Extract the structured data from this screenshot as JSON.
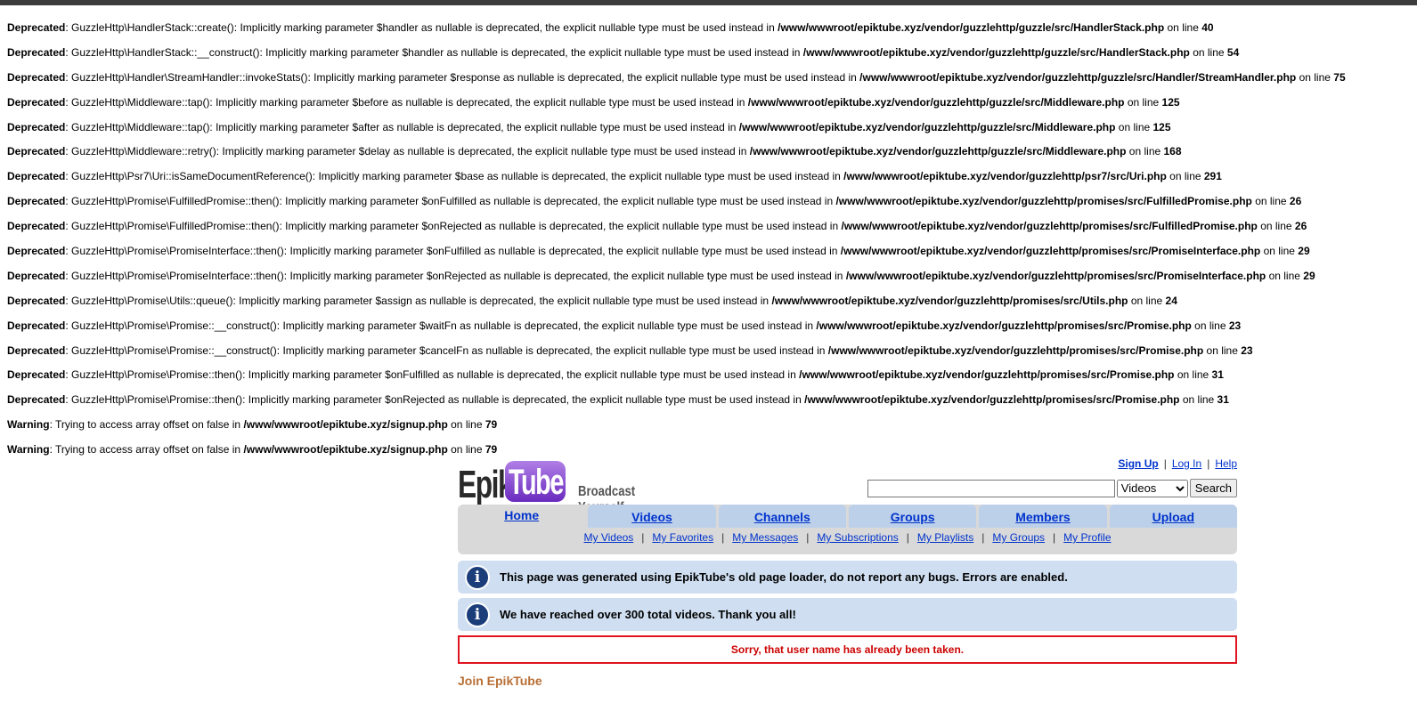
{
  "errors": [
    {
      "level": "Deprecated",
      "msg": ": GuzzleHttp\\HandlerStack::create(): Implicitly marking parameter $handler as nullable is deprecated, the explicit nullable type must be used instead in ",
      "file": "/www/wwwroot/epiktube.xyz/vendor/guzzlehttp/guzzle/src/HandlerStack.php",
      "on": " on line ",
      "line": "40"
    },
    {
      "level": "Deprecated",
      "msg": ": GuzzleHttp\\HandlerStack::__construct(): Implicitly marking parameter $handler as nullable is deprecated, the explicit nullable type must be used instead in ",
      "file": "/www/wwwroot/epiktube.xyz/vendor/guzzlehttp/guzzle/src/HandlerStack.php",
      "on": " on line ",
      "line": "54"
    },
    {
      "level": "Deprecated",
      "msg": ": GuzzleHttp\\Handler\\StreamHandler::invokeStats(): Implicitly marking parameter $response as nullable is deprecated, the explicit nullable type must be used instead in ",
      "file": "/www/wwwroot/epiktube.xyz/vendor/guzzlehttp/guzzle/src/Handler/StreamHandler.php",
      "on": " on line ",
      "line": "75"
    },
    {
      "level": "Deprecated",
      "msg": ": GuzzleHttp\\Middleware::tap(): Implicitly marking parameter $before as nullable is deprecated, the explicit nullable type must be used instead in ",
      "file": "/www/wwwroot/epiktube.xyz/vendor/guzzlehttp/guzzle/src/Middleware.php",
      "on": " on line ",
      "line": "125"
    },
    {
      "level": "Deprecated",
      "msg": ": GuzzleHttp\\Middleware::tap(): Implicitly marking parameter $after as nullable is deprecated, the explicit nullable type must be used instead in ",
      "file": "/www/wwwroot/epiktube.xyz/vendor/guzzlehttp/guzzle/src/Middleware.php",
      "on": " on line ",
      "line": "125"
    },
    {
      "level": "Deprecated",
      "msg": ": GuzzleHttp\\Middleware::retry(): Implicitly marking parameter $delay as nullable is deprecated, the explicit nullable type must be used instead in ",
      "file": "/www/wwwroot/epiktube.xyz/vendor/guzzlehttp/guzzle/src/Middleware.php",
      "on": " on line ",
      "line": "168"
    },
    {
      "level": "Deprecated",
      "msg": ": GuzzleHttp\\Psr7\\Uri::isSameDocumentReference(): Implicitly marking parameter $base as nullable is deprecated, the explicit nullable type must be used instead in ",
      "file": "/www/wwwroot/epiktube.xyz/vendor/guzzlehttp/psr7/src/Uri.php",
      "on": " on line ",
      "line": "291"
    },
    {
      "level": "Deprecated",
      "msg": ": GuzzleHttp\\Promise\\FulfilledPromise::then(): Implicitly marking parameter $onFulfilled as nullable is deprecated, the explicit nullable type must be used instead in ",
      "file": "/www/wwwroot/epiktube.xyz/vendor/guzzlehttp/promises/src/FulfilledPromise.php",
      "on": " on line ",
      "line": "26"
    },
    {
      "level": "Deprecated",
      "msg": ": GuzzleHttp\\Promise\\FulfilledPromise::then(): Implicitly marking parameter $onRejected as nullable is deprecated, the explicit nullable type must be used instead in ",
      "file": "/www/wwwroot/epiktube.xyz/vendor/guzzlehttp/promises/src/FulfilledPromise.php",
      "on": " on line ",
      "line": "26"
    },
    {
      "level": "Deprecated",
      "msg": ": GuzzleHttp\\Promise\\PromiseInterface::then(): Implicitly marking parameter $onFulfilled as nullable is deprecated, the explicit nullable type must be used instead in ",
      "file": "/www/wwwroot/epiktube.xyz/vendor/guzzlehttp/promises/src/PromiseInterface.php",
      "on": " on line ",
      "line": "29"
    },
    {
      "level": "Deprecated",
      "msg": ": GuzzleHttp\\Promise\\PromiseInterface::then(): Implicitly marking parameter $onRejected as nullable is deprecated, the explicit nullable type must be used instead in ",
      "file": "/www/wwwroot/epiktube.xyz/vendor/guzzlehttp/promises/src/PromiseInterface.php",
      "on": " on line ",
      "line": "29"
    },
    {
      "level": "Deprecated",
      "msg": ": GuzzleHttp\\Promise\\Utils::queue(): Implicitly marking parameter $assign as nullable is deprecated, the explicit nullable type must be used instead in ",
      "file": "/www/wwwroot/epiktube.xyz/vendor/guzzlehttp/promises/src/Utils.php",
      "on": " on line ",
      "line": "24"
    },
    {
      "level": "Deprecated",
      "msg": ": GuzzleHttp\\Promise\\Promise::__construct(): Implicitly marking parameter $waitFn as nullable is deprecated, the explicit nullable type must be used instead in ",
      "file": "/www/wwwroot/epiktube.xyz/vendor/guzzlehttp/promises/src/Promise.php",
      "on": " on line ",
      "line": "23"
    },
    {
      "level": "Deprecated",
      "msg": ": GuzzleHttp\\Promise\\Promise::__construct(): Implicitly marking parameter $cancelFn as nullable is deprecated, the explicit nullable type must be used instead in ",
      "file": "/www/wwwroot/epiktube.xyz/vendor/guzzlehttp/promises/src/Promise.php",
      "on": " on line ",
      "line": "23"
    },
    {
      "level": "Deprecated",
      "msg": ": GuzzleHttp\\Promise\\Promise::then(): Implicitly marking parameter $onFulfilled as nullable is deprecated, the explicit nullable type must be used instead in ",
      "file": "/www/wwwroot/epiktube.xyz/vendor/guzzlehttp/promises/src/Promise.php",
      "on": " on line ",
      "line": "31"
    },
    {
      "level": "Deprecated",
      "msg": ": GuzzleHttp\\Promise\\Promise::then(): Implicitly marking parameter $onRejected as nullable is deprecated, the explicit nullable type must be used instead in ",
      "file": "/www/wwwroot/epiktube.xyz/vendor/guzzlehttp/promises/src/Promise.php",
      "on": " on line ",
      "line": "31"
    },
    {
      "level": "Warning",
      "msg": ": Trying to access array offset on false in ",
      "file": "/www/wwwroot/epiktube.xyz/signup.php",
      "on": " on line ",
      "line": "79"
    },
    {
      "level": "Warning",
      "msg": ": Trying to access array offset on false in ",
      "file": "/www/wwwroot/epiktube.xyz/signup.php",
      "on": " on line ",
      "line": "79"
    }
  ],
  "header": {
    "logo_left": "Epik",
    "logo_right": "Tube",
    "slogan": "Broadcast Yourself",
    "links": {
      "signup": "Sign Up",
      "login": "Log In",
      "help": "Help",
      "sep": "|"
    }
  },
  "search": {
    "value": "",
    "scope": "Videos",
    "button": "Search"
  },
  "nav": {
    "tabs": [
      "Home",
      "Videos",
      "Channels",
      "Groups",
      "Members",
      "Upload"
    ],
    "active_tab": "Home",
    "sub": [
      "My Videos",
      "My Favorites",
      "My Messages",
      "My Subscriptions",
      "My Playlists",
      "My Groups",
      "My Profile"
    ]
  },
  "notices": [
    "This page was generated using EpikTube's old page loader, do not report any bugs. Errors are enabled.",
    "We have reached over 300 total videos. Thank you all!"
  ],
  "notice_icon": "info-icon",
  "error_message": "Sorry, that user name has already been taken.",
  "join_heading": "Join EpikTube",
  "colors": {
    "link": "#0033cc",
    "tab": "#bcd0ea",
    "notice": "#cfdff1",
    "error_border": "#e0141e",
    "join": "#b86f36"
  }
}
